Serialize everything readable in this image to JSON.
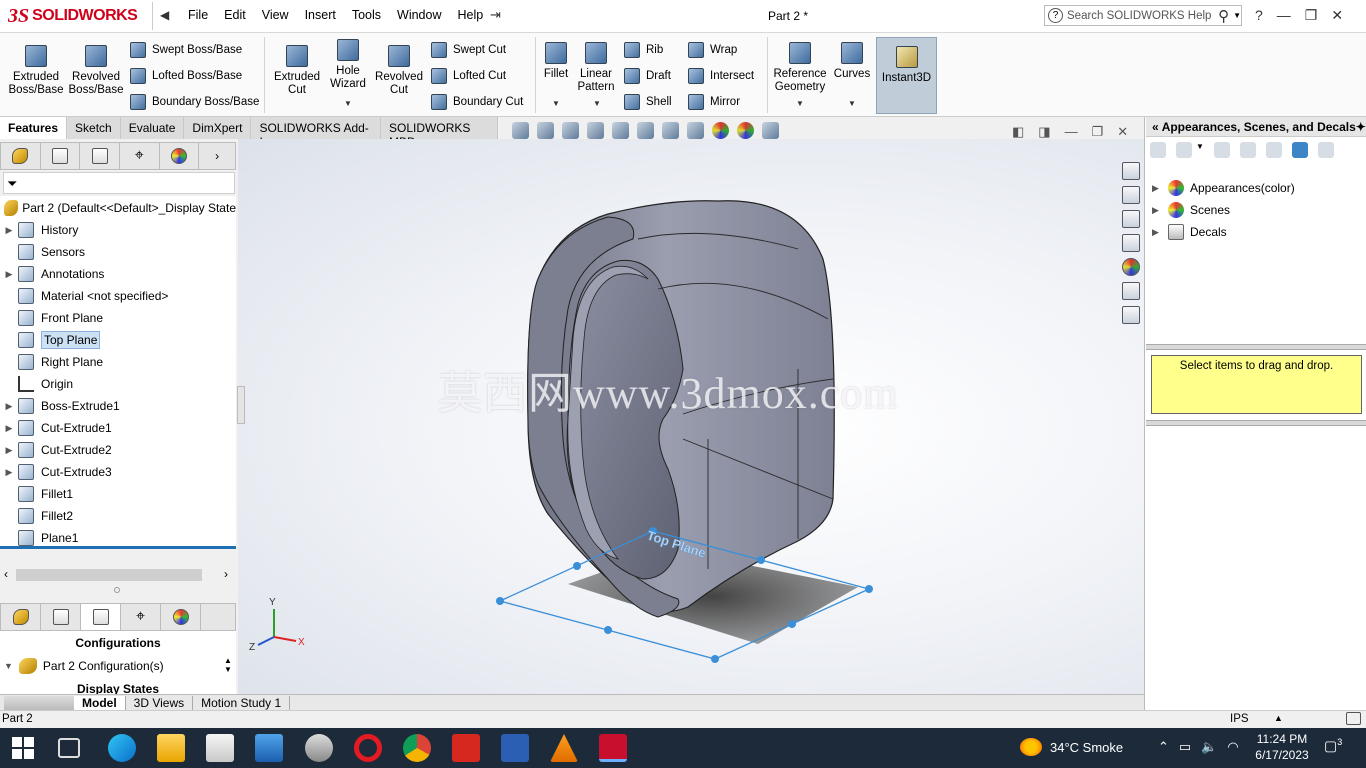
{
  "app": {
    "brand_prefix": "3S",
    "brand_name": "SOLIDWORKS",
    "document_title": "Part 2 *",
    "search_placeholder": "Search SOLIDWORKS Help",
    "help_symbol": "?"
  },
  "menu": [
    "File",
    "Edit",
    "View",
    "Insert",
    "Tools",
    "Window",
    "Help"
  ],
  "ribbon": {
    "big_buttons": [
      {
        "label": "Extruded Boss/Base"
      },
      {
        "label": "Revolved Boss/Base"
      },
      {
        "label": "Extruded Cut"
      },
      {
        "label": "Hole Wizard"
      },
      {
        "label": "Revolved Cut"
      },
      {
        "label": "Fillet"
      },
      {
        "label": "Linear Pattern"
      },
      {
        "label": "Reference Geometry"
      },
      {
        "label": "Curves"
      },
      {
        "label": "Instant3D"
      }
    ],
    "small_buttons": [
      {
        "label": "Swept Boss/Base"
      },
      {
        "label": "Lofted Boss/Base"
      },
      {
        "label": "Boundary Boss/Base"
      },
      {
        "label": "Swept Cut"
      },
      {
        "label": "Lofted Cut"
      },
      {
        "label": "Boundary Cut"
      },
      {
        "label": "Rib"
      },
      {
        "label": "Draft"
      },
      {
        "label": "Shell"
      },
      {
        "label": "Wrap"
      },
      {
        "label": "Intersect"
      },
      {
        "label": "Mirror"
      }
    ]
  },
  "command_tabs": [
    "Features",
    "Sketch",
    "Evaluate",
    "DimXpert",
    "SOLIDWORKS Add-Ins",
    "SOLIDWORKS MBD"
  ],
  "tree": {
    "root": "Part 2  (Default<<Default>_Display State",
    "items": [
      {
        "label": "History",
        "expandable": true
      },
      {
        "label": "Sensors",
        "expandable": false
      },
      {
        "label": "Annotations",
        "expandable": true
      },
      {
        "label": "Material <not specified>",
        "expandable": false
      },
      {
        "label": "Front Plane",
        "expandable": false
      },
      {
        "label": "Top Plane",
        "expandable": false,
        "selected": true
      },
      {
        "label": "Right Plane",
        "expandable": false
      },
      {
        "label": "Origin",
        "expandable": false
      },
      {
        "label": "Boss-Extrude1",
        "expandable": true
      },
      {
        "label": "Cut-Extrude1",
        "expandable": true
      },
      {
        "label": "Cut-Extrude2",
        "expandable": true
      },
      {
        "label": "Cut-Extrude3",
        "expandable": true
      },
      {
        "label": "Fillet1",
        "expandable": false
      },
      {
        "label": "Fillet2",
        "expandable": false
      },
      {
        "label": "Plane1",
        "expandable": false
      }
    ]
  },
  "configurations": {
    "title": "Configurations",
    "item": "Part 2 Configuration(s)",
    "display_states": "Display States"
  },
  "viewport": {
    "watermark": "莫西网www.3dmox.com",
    "plane_label": "Top Plane",
    "triad": {
      "y": "Y",
      "x": "X",
      "z": "Z"
    }
  },
  "task_pane": {
    "title": "Appearances, Scenes, and Decals",
    "items": [
      "Appearances(color)",
      "Scenes",
      "Decals"
    ],
    "drop_hint": "Select items to drag and drop."
  },
  "bottom_tabs": [
    "Model",
    "3D Views",
    "Motion Study 1"
  ],
  "status": {
    "left_text": "Part 2",
    "units": "IPS"
  },
  "taskbar": {
    "weather": "34°C  Smoke",
    "time": "11:24 PM",
    "date": "6/17/2023",
    "notifications": "3"
  }
}
